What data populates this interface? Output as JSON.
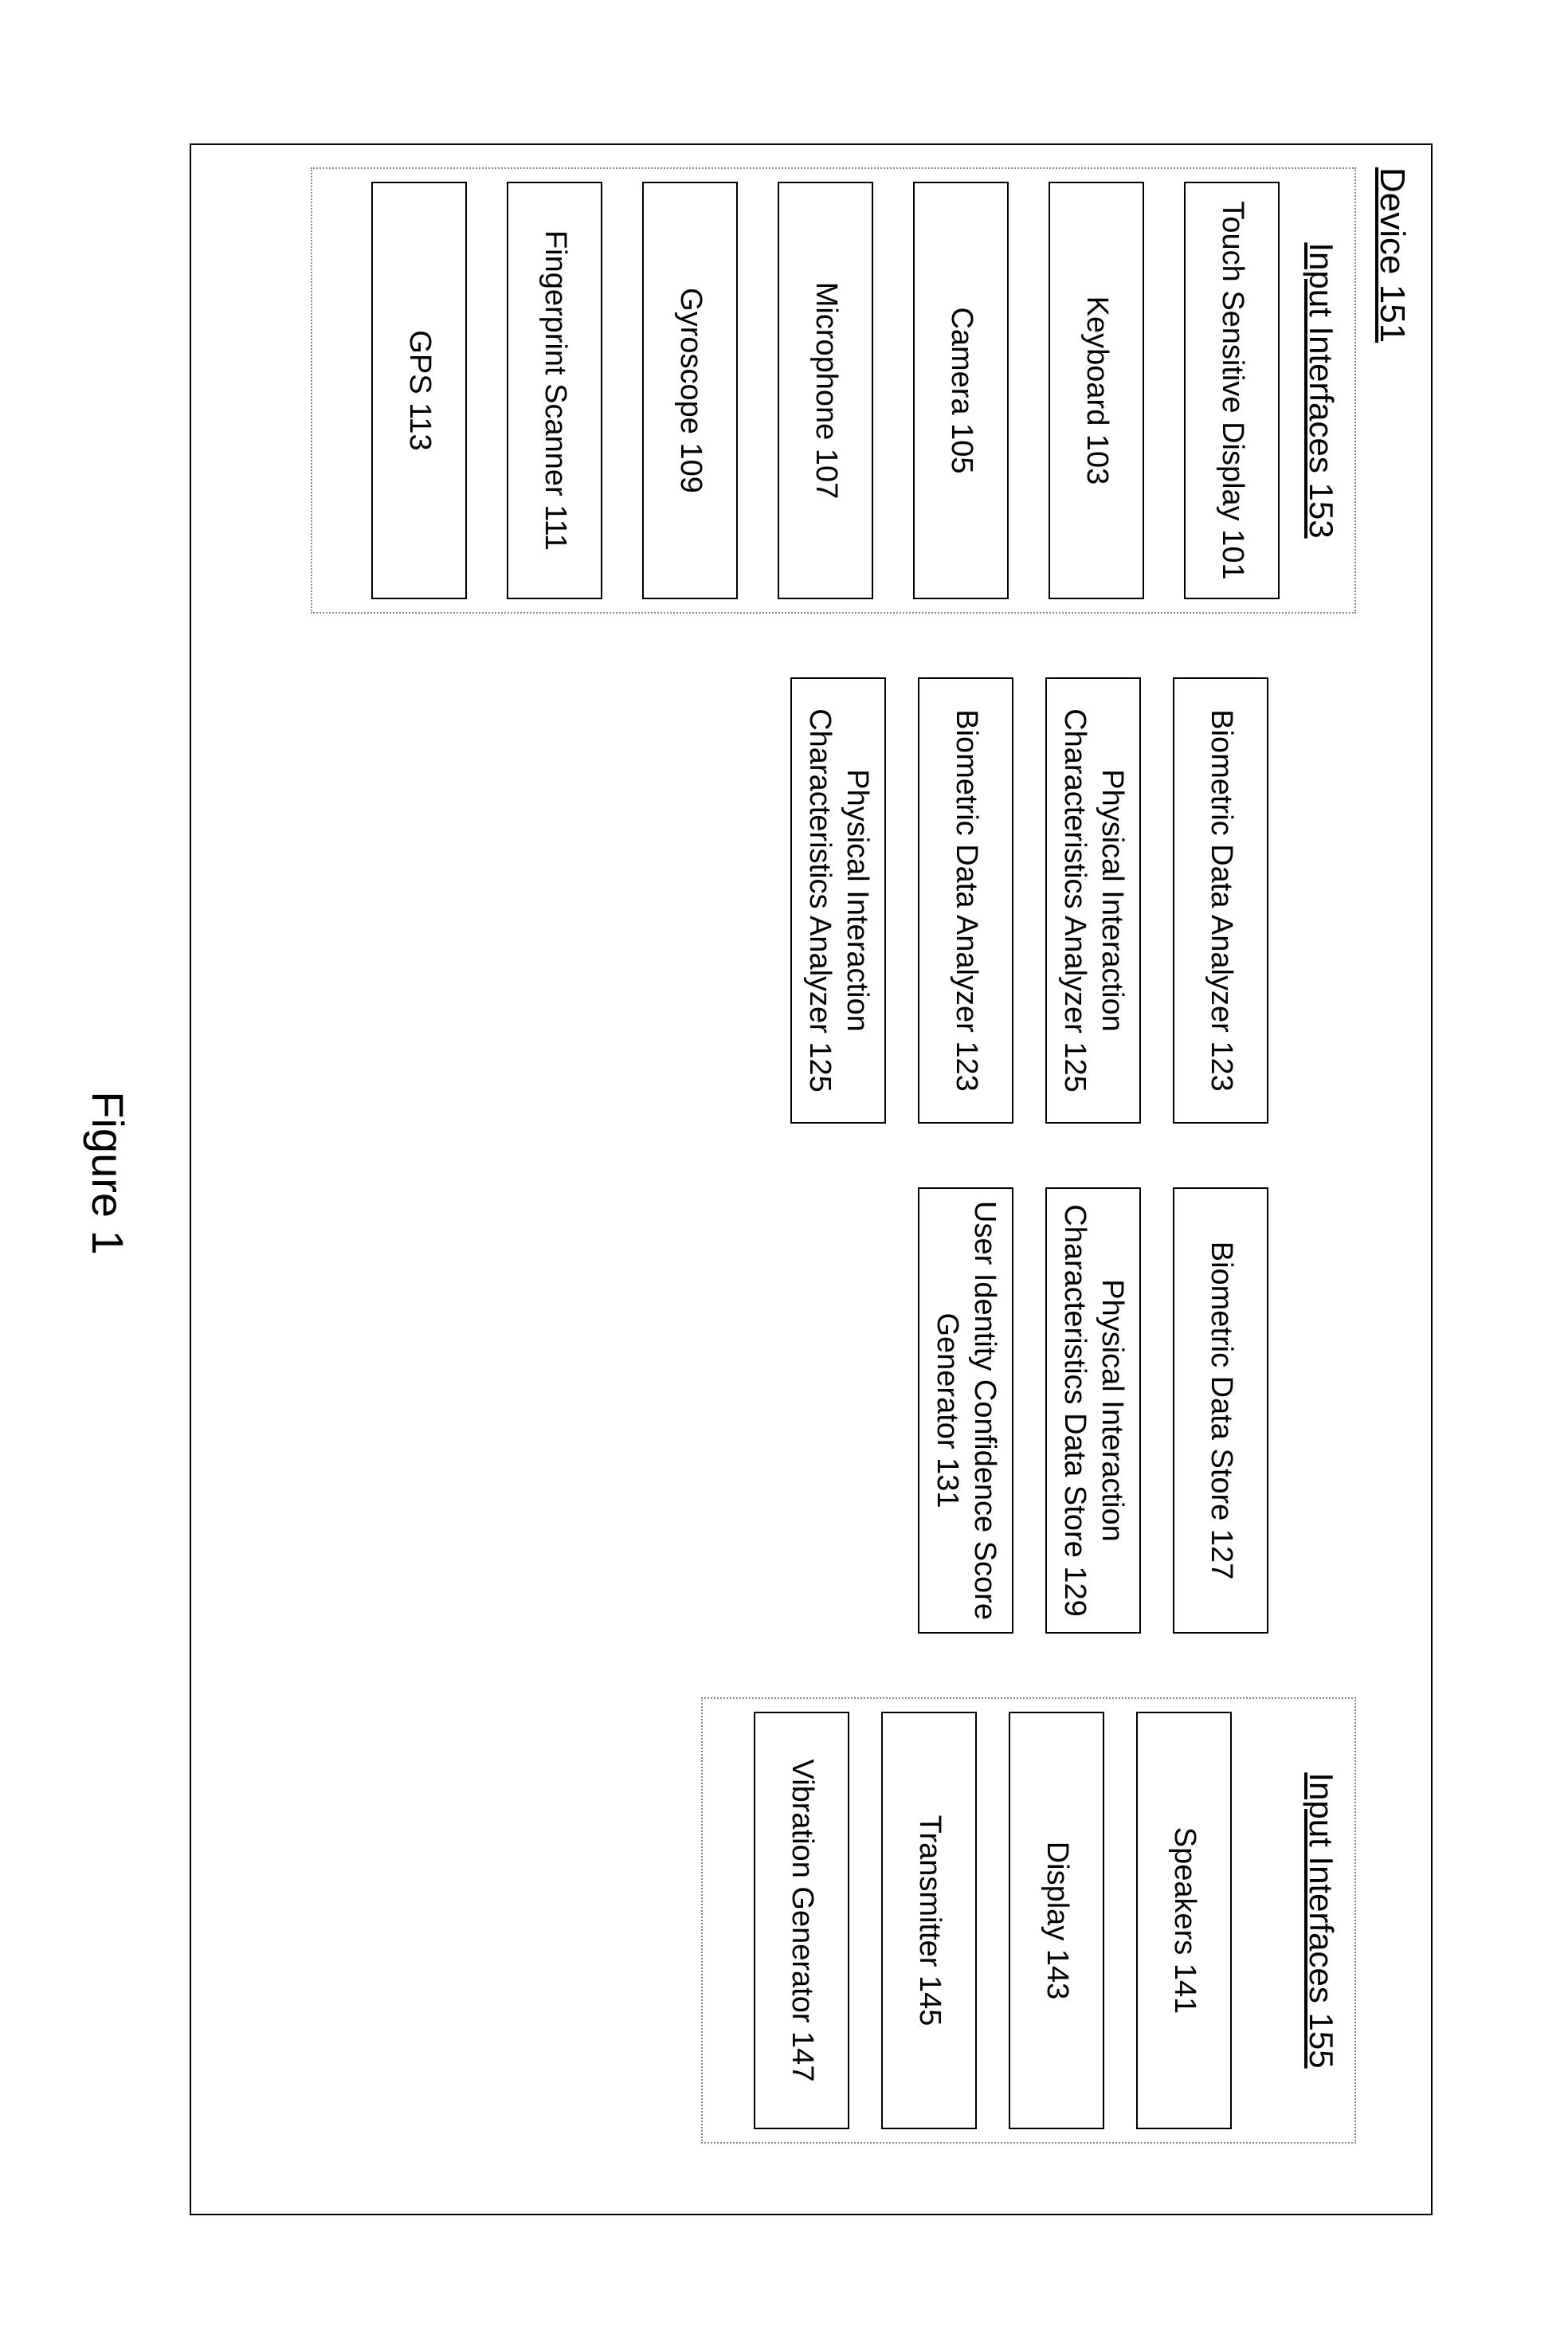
{
  "figure_caption": "Figure 1",
  "device": {
    "title": "Device 151",
    "input": {
      "title": "Input Interfaces 153",
      "items": [
        "Touch Sensitive Display 101",
        "Keyboard 103",
        "Camera 105",
        "Microphone 107",
        "Gyroscope 109",
        "Fingerprint Scanner 111",
        "GPS 113"
      ]
    },
    "mid1": {
      "items": [
        "Biometric Data Analyzer 123",
        "Physical Interaction Characteristics Analyzer 125",
        "Biometric Data Analyzer 123",
        "Physical Interaction Characteristics Analyzer 125"
      ]
    },
    "mid2": {
      "items": [
        "Biometric Data Store 127",
        "Physical Interaction Characteristics Data Store 129",
        "User Identity Confidence Score Generator 131"
      ]
    },
    "output": {
      "title": "Input Interfaces 155",
      "items": [
        "Speakers 141",
        "Display 143",
        "Transmitter 145",
        "Vibration Generator 147"
      ]
    }
  }
}
